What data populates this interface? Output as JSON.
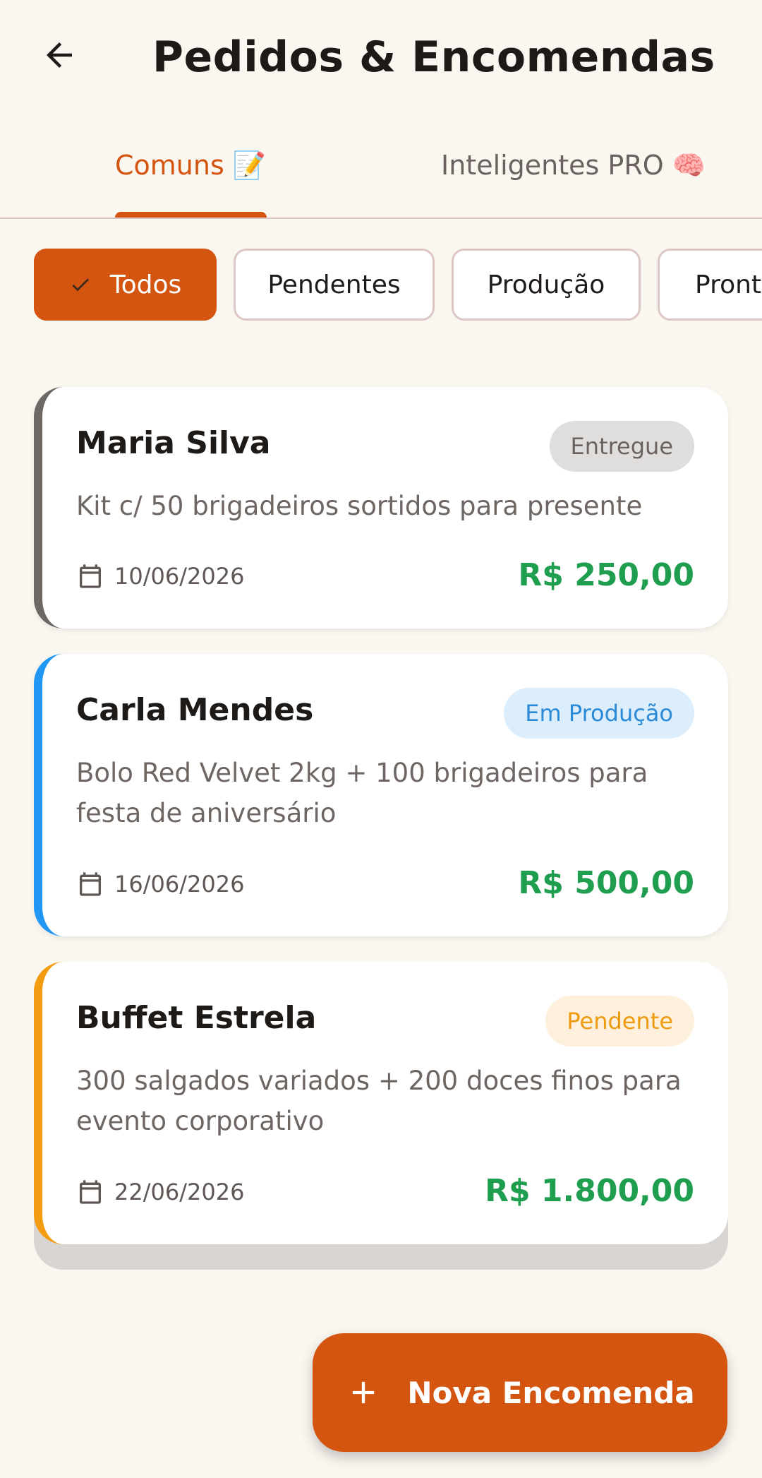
{
  "header": {
    "title": "Pedidos & Encomendas",
    "back_icon": "arrow-left-icon"
  },
  "tabs": [
    {
      "label": "Comuns 📝",
      "selected": true
    },
    {
      "label": "Inteligentes PRO 🧠",
      "selected": false
    }
  ],
  "filters": [
    {
      "label": "Todos",
      "selected": true,
      "icon": "check-icon"
    },
    {
      "label": "Pendentes",
      "selected": false
    },
    {
      "label": "Produção",
      "selected": false
    },
    {
      "label": "Prontos",
      "selected": false
    }
  ],
  "orders": [
    {
      "client": "Maria Silva",
      "status": "Entregue",
      "description": "Kit c/ 50 brigadeiros sortidos para presente",
      "date": "10/06/2026",
      "amount": "R$ 250,00",
      "accent_color": "#6E6865"
    },
    {
      "client": "Carla Mendes",
      "status": "Em Produção",
      "description": "Bolo Red Velvet 2kg + 100 brigadeiros para festa de aniversário",
      "date": "16/06/2026",
      "amount": "R$ 500,00",
      "accent_color": "#2196F3"
    },
    {
      "client": "Buffet Estrela",
      "status": "Pendente",
      "description": "300 salgados variados + 200 doces finos para evento corporativo",
      "date": "22/06/2026",
      "amount": "R$ 1.800,00",
      "accent_color": "#F39C12"
    }
  ],
  "fab": {
    "label": "Nova Encomenda",
    "icon": "plus-icon"
  },
  "colors": {
    "primary": "#D3550F",
    "background": "#FAF6F0",
    "amount": "#1E9E4E"
  }
}
